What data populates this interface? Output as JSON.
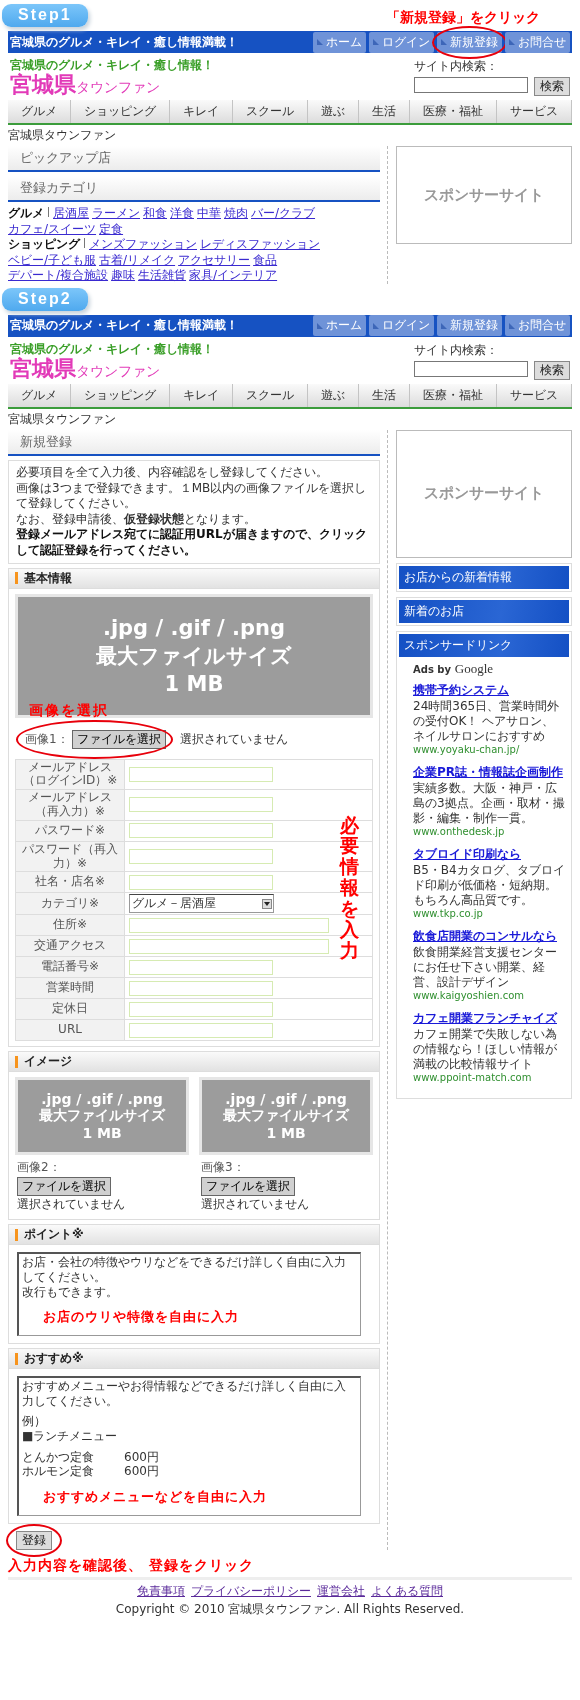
{
  "steps": [
    {
      "badge": "Step1",
      "callout": "「新規登録」をクリック",
      "header": {
        "tagline": "宮城県のグルメ・キレイ・癒し情報満載！",
        "top_links": [
          {
            "label": "ホーム",
            "circled": false
          },
          {
            "label": "ログイン",
            "circled": false
          },
          {
            "label": "新規登録",
            "circled": true
          },
          {
            "label": "お問合せ",
            "circled": false
          }
        ],
        "logo_sub": "宮城県のグルメ・キレイ・癒し情報！",
        "logo_main": "宮城県",
        "logo_suffix": "タウンファン",
        "search_label": "サイト内検索：",
        "search_button": "検索",
        "nav": [
          "グルメ",
          "ショッピング",
          "キレイ",
          "スクール",
          "遊ぶ",
          "生活",
          "医療・福祉",
          "サービス"
        ],
        "breadcrumb": "宮城県タウンファン"
      },
      "page": {
        "kind": "home",
        "panels": [
          "ピックアップ店",
          "登録カテゴリ"
        ],
        "categories": [
          {
            "name": "グルメ",
            "links": [
              "居酒屋",
              "ラーメン",
              "和食",
              "洋食",
              "中華",
              "焼肉",
              "バー/クラブ",
              "カフェ/スイーツ",
              "定食"
            ]
          },
          {
            "name": "ショッピング",
            "links": [
              "メンズファッション",
              "レディスファッション",
              "ベビー/子ども服",
              "古着/リメイク",
              "アクセサリー",
              "食品",
              "デパート/複合施設",
              "趣味",
              "生活雑貨",
              "家具/インテリア"
            ]
          }
        ]
      },
      "side": {
        "sponsor": "スポンサーサイト"
      }
    },
    {
      "badge": "Step2",
      "header": {
        "tagline": "宮城県のグルメ・キレイ・癒し情報満載！",
        "top_links": [
          {
            "label": "ホーム",
            "circled": false
          },
          {
            "label": "ログイン",
            "circled": false
          },
          {
            "label": "新規登録",
            "circled": false
          },
          {
            "label": "お問合せ",
            "circled": false
          }
        ],
        "logo_sub": "宮城県のグルメ・キレイ・癒し情報！",
        "logo_main": "宮城県",
        "logo_suffix": "タウンファン",
        "search_label": "サイト内検索：",
        "search_button": "検索",
        "nav": [
          "グルメ",
          "ショッピング",
          "キレイ",
          "スクール",
          "遊ぶ",
          "生活",
          "医療・福祉",
          "サービス"
        ],
        "breadcrumb": "宮城県タウンファン"
      },
      "page": {
        "kind": "register",
        "title": "新規登録",
        "intro": [
          {
            "text": "必要項目を全て入力後、内容確認をし登録してください。",
            "bold": false
          },
          {
            "text": "画像は3つまで登録できます。１MB以内の画像ファイルを選択して登録してください。",
            "bold": false
          },
          {
            "text": "なお、登録申請後、**仮登録状態**となります。",
            "bold": false
          },
          {
            "text": "登録メールアドレス宛てに認証用URLが届きますので、クリックして認証登録を行ってください。",
            "bold": true
          }
        ],
        "basic": {
          "heading": "基本情報",
          "slot": {
            "lines": [
              ".jpg / .gif / .png",
              "最大ファイルサイズ",
              "1 MB"
            ],
            "label": "画像1：",
            "button": "ファイルを選択",
            "status": "選択されていません",
            "circled": true,
            "callout": "画像を選択"
          },
          "fields": [
            {
              "label": "メールアドレス（ログインID）※",
              "kind": "text",
              "wide": false
            },
            {
              "label": "メールアドレス（再入力）※",
              "kind": "text",
              "wide": false
            },
            {
              "label": "パスワード※",
              "kind": "text",
              "wide": false
            },
            {
              "label": "パスワード（再入力）※",
              "kind": "text",
              "wide": false
            },
            {
              "label": "社名・店名※",
              "kind": "text",
              "wide": false
            },
            {
              "label": "カテゴリ※",
              "kind": "select",
              "value": "グルメ－居酒屋"
            },
            {
              "label": "住所※",
              "kind": "text",
              "wide": true
            },
            {
              "label": "交通アクセス",
              "kind": "text",
              "wide": true
            },
            {
              "label": "電話番号※",
              "kind": "text",
              "wide": false
            },
            {
              "label": "営業時間",
              "kind": "text",
              "wide": false
            },
            {
              "label": "定休日",
              "kind": "text",
              "wide": false
            },
            {
              "label": "URL",
              "kind": "text",
              "wide": false
            }
          ],
          "callout": "必要情報を入力"
        },
        "images": {
          "heading": "イメージ",
          "slots": [
            {
              "lines": [
                ".jpg / .gif / .png",
                "最大ファイルサイズ",
                "1 MB"
              ],
              "label": "画像2：",
              "button": "ファイルを選択",
              "status": "選択されていません",
              "circled": false
            },
            {
              "lines": [
                ".jpg / .gif / .png",
                "最大ファイルサイズ",
                "1 MB"
              ],
              "label": "画像3：",
              "button": "ファイルを選択",
              "status": "選択されていません",
              "circled": false
            }
          ]
        },
        "point": {
          "heading": "ポイント※",
          "blocks": [
            [
              {
                "text": "お店・会社の特徴やウリなどをできるだけ詳しく自由に入力してください。"
              },
              {
                "text": "改行もできます。"
              }
            ]
          ],
          "callout": "お店のウリや特徴を自由に入力"
        },
        "recommend": {
          "heading": "おすすめ※",
          "blocks": [
            [
              {
                "text": "おすすめメニューやお得情報などできるだけ詳しく自由に入力してください。"
              }
            ],
            [
              {
                "text": "例）"
              },
              {
                "text": "■ランチメニュー"
              }
            ],
            [
              {
                "text": "とんかつ定食",
                "price": "600円"
              },
              {
                "text": "ホルモン定食",
                "price": "600円"
              }
            ]
          ],
          "callout": "おすすめメニューなどを自由に入力"
        },
        "submit": {
          "label": "登録",
          "circled": true,
          "callout": "入力内容を確認後、 登録をクリック"
        }
      },
      "side": {
        "sponsor": "スポンサーサイト",
        "boxes": [
          "お店からの新着情報",
          "新着のお店"
        ],
        "ads_heading": "スポンサードリンク",
        "ads_by": "Ads by",
        "ads_brand": "Google",
        "ads": [
          {
            "title": "携帯予約システム",
            "body": "24時間365日、営業時間外の受付OK！ ヘアサロン、ネイルサロンにおすすめ",
            "url": "www.yoyaku-chan.jp/"
          },
          {
            "title": "企業PR誌・情報誌企画制作",
            "body": "実績多数。大阪・神戸・広島の3拠点。企画・取材・撮影・編集・制作一貫。",
            "url": "www.onthedesk.jp"
          },
          {
            "title": "タブロイド印刷なら",
            "body": "B5・B4カタログ、タブロイド印刷が低価格・短納期。もちろん高品質です。",
            "url": "www.tkp.co.jp"
          },
          {
            "title": "飲食店開業のコンサルなら",
            "body": "飲食開業経営支援センターにお任せ下さい開業、経営、設計デザイン",
            "url": "www.kaigyoshien.com"
          },
          {
            "title": "カフェ開業フランチャイズ",
            "body": "カフェ開業で失敗しない為の情報なら！ほしい情報が満載の比較情報サイト",
            "url": "www.ppoint-match.com"
          }
        ]
      },
      "footer": {
        "links": [
          "免責事項",
          "プライバシーポリシー",
          "運営会社",
          "よくある質問"
        ],
        "copyright": "Copyright © 2010 宮城県タウンファン. All Rights Reserved."
      }
    }
  ]
}
